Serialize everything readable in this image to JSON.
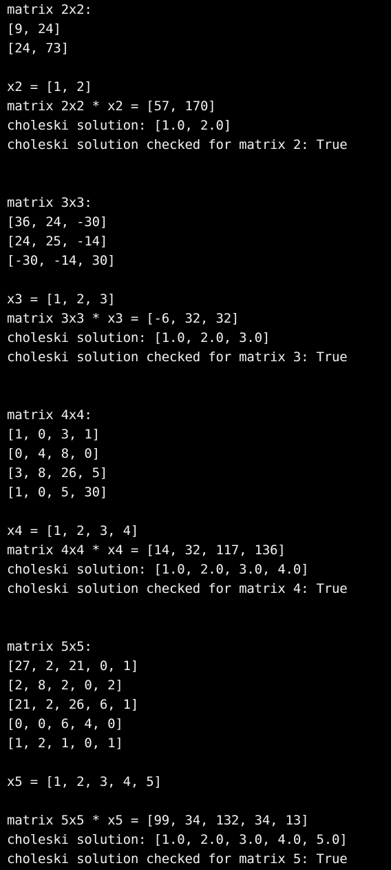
{
  "terminal": {
    "lines": [
      "matrix 2x2:",
      "[9, 24]",
      "[24, 73]",
      "",
      "x2 = [1, 2]",
      "matrix 2x2 * x2 = [57, 170]",
      "choleski solution: [1.0, 2.0]",
      "choleski solution checked for matrix 2: True",
      "",
      "",
      "matrix 3x3:",
      "[36, 24, -30]",
      "[24, 25, -14]",
      "[-30, -14, 30]",
      "",
      "x3 = [1, 2, 3]",
      "matrix 3x3 * x3 = [-6, 32, 32]",
      "choleski solution: [1.0, 2.0, 3.0]",
      "choleski solution checked for matrix 3: True",
      "",
      "",
      "matrix 4x4:",
      "[1, 0, 3, 1]",
      "[0, 4, 8, 0]",
      "[3, 8, 26, 5]",
      "[1, 0, 5, 30]",
      "",
      "x4 = [1, 2, 3, 4]",
      "matrix 4x4 * x4 = [14, 32, 117, 136]",
      "choleski solution: [1.0, 2.0, 3.0, 4.0]",
      "choleski solution checked for matrix 4: True",
      "",
      "",
      "matrix 5x5:",
      "[27, 2, 21, 0, 1]",
      "[2, 8, 2, 0, 2]",
      "[21, 2, 26, 6, 1]",
      "[0, 0, 6, 4, 0]",
      "[1, 2, 1, 0, 1]",
      "",
      "x5 = [1, 2, 3, 4, 5]",
      "",
      "matrix 5x5 * x5 = [99, 34, 132, 34, 13]",
      "choleski solution: [1.0, 2.0, 3.0, 4.0, 5.0]",
      "choleski solution checked for matrix 5: True"
    ]
  }
}
